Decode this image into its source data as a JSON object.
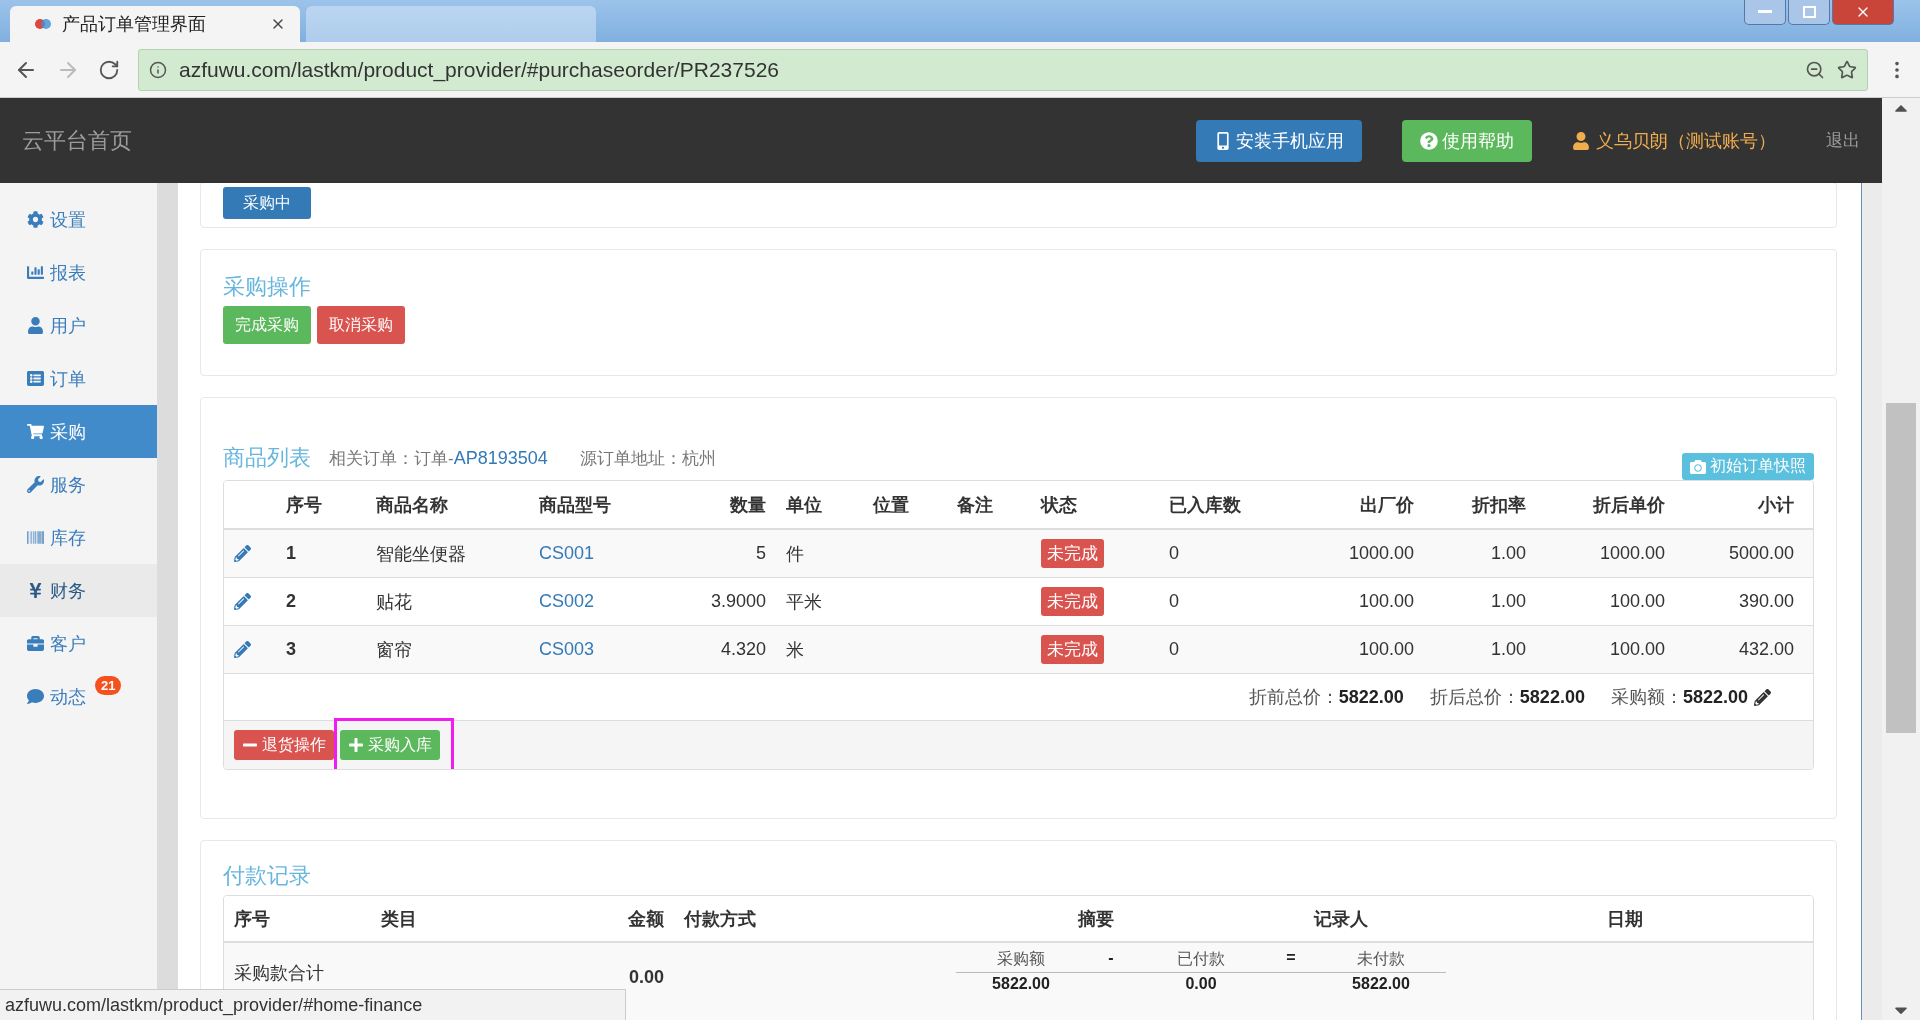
{
  "browser": {
    "tabs": [
      {
        "title": "产品订单管理界面",
        "selected": true
      },
      {
        "selected": false
      }
    ],
    "url": "azfuwu.com/lastkm/product_provider/#purchaseorder/PR237526"
  },
  "header": {
    "brand": "云平台首页",
    "install_button": "安装手机应用",
    "help_button": "使用帮助",
    "user": "义乌贝朗（测试账号）",
    "logout": "退出"
  },
  "sidebar": {
    "items": [
      {
        "label": "设置",
        "kind": "gear",
        "selected": false,
        "hovered": false
      },
      {
        "label": "报表",
        "kind": "chart",
        "selected": false,
        "hovered": false
      },
      {
        "label": "用户",
        "kind": "user",
        "selected": false,
        "hovered": false
      },
      {
        "label": "订单",
        "kind": "list",
        "selected": false,
        "hovered": false
      },
      {
        "label": "采购",
        "kind": "cart",
        "selected": true,
        "hovered": false
      },
      {
        "label": "服务",
        "kind": "wrench",
        "selected": false,
        "hovered": false
      },
      {
        "label": "库存",
        "kind": "barcode",
        "selected": false,
        "hovered": false
      },
      {
        "label": "财务",
        "kind": "yen",
        "selected": false,
        "hovered": true
      },
      {
        "label": "客户",
        "kind": "briefcase",
        "selected": false,
        "hovered": false
      },
      {
        "label": "动态",
        "kind": "comment",
        "selected": false,
        "hovered": false,
        "badge": "21"
      }
    ]
  },
  "status_card": {
    "button": "采购中"
  },
  "operations": {
    "title": "采购操作",
    "buttons": [
      {
        "label": "完成采购",
        "kind": "success"
      },
      {
        "label": "取消采购",
        "kind": "danger"
      }
    ]
  },
  "products": {
    "title": "商品列表",
    "related_label": "相关订单：订单-",
    "related_link": "AP8193504",
    "source": "源订单地址：杭州",
    "snapshot_button": "初始订单快照",
    "columns": [
      "序号",
      "商品名称",
      "商品型号",
      "数量",
      "单位",
      "位置",
      "备注",
      "状态",
      "已入库数",
      "出厂价",
      "折扣率",
      "折后单价",
      "小计"
    ],
    "rows": [
      {
        "no": "1",
        "name": "智能坐便器",
        "model": "CS001",
        "qty": "5",
        "unit": "件",
        "status": "未完成",
        "received": "0",
        "price": "1000.00",
        "discount": "1.00",
        "net_price": "1000.00",
        "subtotal": "5000.00"
      },
      {
        "no": "2",
        "name": "贴花",
        "model": "CS002",
        "qty": "3.9000",
        "unit": "平米",
        "status": "未完成",
        "received": "0",
        "price": "100.00",
        "discount": "1.00",
        "net_price": "100.00",
        "subtotal": "390.00"
      },
      {
        "no": "3",
        "name": "窗帘",
        "model": "CS003",
        "qty": "4.320",
        "unit": "米",
        "status": "未完成",
        "received": "0",
        "price": "100.00",
        "discount": "1.00",
        "net_price": "100.00",
        "subtotal": "432.00"
      }
    ],
    "totals": [
      "折前总价：**5822.00**",
      "折后总价：**5822.00**",
      "采购额：**5822.00**"
    ],
    "actions": [
      {
        "label": "退货操作",
        "kind": "danger",
        "highlighted": false
      },
      {
        "label": "采购入库",
        "kind": "success",
        "highlighted": true
      }
    ]
  },
  "payments": {
    "title": "付款记录",
    "columns": [
      "序号",
      "类目",
      "金额",
      "付款方式",
      "摘要",
      "记录人",
      "日期"
    ],
    "summary_label": "采购款合计",
    "amount": "0.00",
    "formula": [
      {
        "label": "采购额",
        "value": "5822.00"
      },
      {
        "op": "-"
      },
      {
        "label": "已付款",
        "value": "0.00"
      },
      {
        "op": "="
      },
      {
        "label": "未付款",
        "value": "5822.00"
      }
    ]
  },
  "status_bar": "azfuwu.com/lastkm/product_provider/#home-finance"
}
